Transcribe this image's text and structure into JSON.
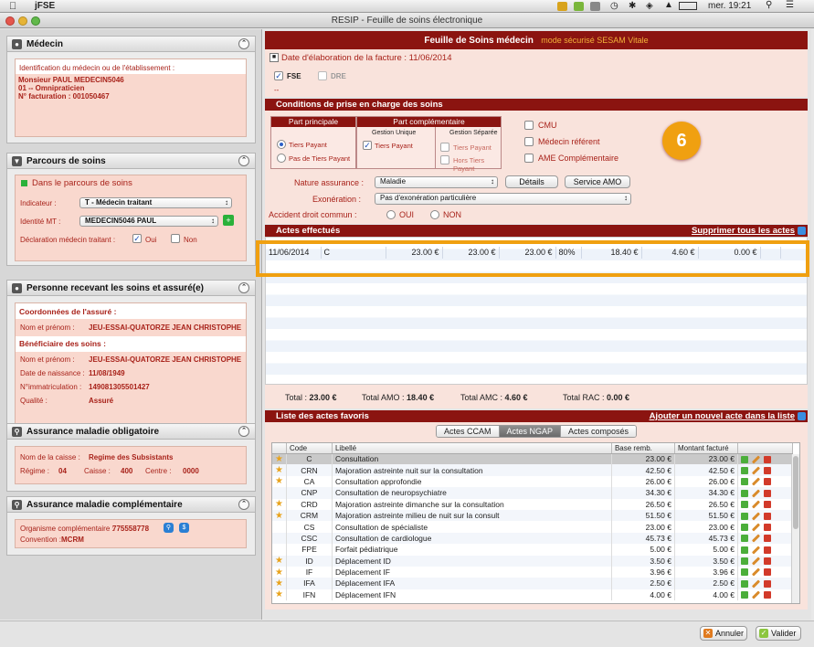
{
  "menubar": {
    "apple": "",
    "app": "jFSE",
    "clock": "mer. 19:21"
  },
  "window": {
    "title": "RESIP - Feuille de soins électronique"
  },
  "medecin": {
    "title": "Médecin",
    "ident_label": "Identification du médecin ou de l'établissement :",
    "line1": "Monsieur PAUL MEDECIN5046",
    "line2": "01 -- Omnipraticien",
    "line3": "N° facturation : 001050467"
  },
  "parcours": {
    "title": "Parcours de soins",
    "status": "Dans le parcours de soins",
    "indicateur_label": "Indicateur :",
    "indicateur_value": "T - Médecin traitant",
    "identite_label": "Identité MT :",
    "identite_value": "MEDECIN5046 PAUL",
    "declaration_label": "Déclaration médecin traitant :",
    "oui": "Oui",
    "non": "Non"
  },
  "personne": {
    "title": "Personne recevant les soins et assuré(e)",
    "coord_label": "Coordonnées de l'assuré :",
    "nom_label": "Nom et prénom :",
    "nom_value": "JEU-ESSAI-QUATORZE JEAN CHRISTOPHE",
    "benef_label": "Bénéficiaire des soins :",
    "nom2_label": "Nom et prénom :",
    "nom2_value": "JEU-ESSAI-QUATORZE JEAN CHRISTOPHE",
    "naissance_label": "Date de naissance :",
    "naissance_value": "11/08/1949",
    "immat_label": "N°immatriculation :",
    "immat_value": "149081305501427",
    "qualite_label": "Qualité :",
    "qualite_value": "Assuré"
  },
  "amo": {
    "title": "Assurance maladie obligatoire",
    "caisse_label": "Nom de la caisse :",
    "caisse_value": "Regime des Subsistants",
    "regime_label": "Régime :",
    "regime_value": "04",
    "caisse2_label": "Caisse :",
    "caisse2_value": "400",
    "centre_label": "Centre :",
    "centre_value": "0000"
  },
  "amc": {
    "title": "Assurance maladie complémentaire",
    "org_label": "Organisme complémentaire :",
    "org_value": "775558778",
    "conv_label": "Convention :",
    "conv_value": "MCRM"
  },
  "feuille": {
    "title": "Feuille de Soins médecin",
    "mode": "mode sécurisé SESAM Vitale",
    "date_label": "Date d'élaboration de la facture : 11/06/2014",
    "fse": "FSE",
    "dre": "DRE",
    "dashes": "--"
  },
  "conditions": {
    "title": "Conditions de prise en charge des soins",
    "part_principale": "Part principale",
    "part_comp": "Part complémentaire",
    "gestion_unique": "Gestion Unique",
    "gestion_separee": "Gestion Séparée",
    "tiers_payant": "Tiers Payant",
    "pas_tiers": "Pas de Tiers Payant",
    "tiers_payant2": "Tiers Payant",
    "tiers_payant3": "Tiers Payant",
    "hors_tiers": "Hors Tiers Payant",
    "cmu": "CMU",
    "medecin_refere": "Médecin référent",
    "ame": "AME Complémentaire",
    "nature_label": "Nature assurance :",
    "nature_value": "Maladie",
    "details": "Détails",
    "service_amo": "Service AMO",
    "exo_label": "Exonération :",
    "exo_value": "Pas d'exonération particulière",
    "accident_label": "Accident droit commun :",
    "oui": "OUI",
    "non": "NON",
    "badge": "6"
  },
  "actes": {
    "title": "Actes effectués",
    "delete_all": "Supprimer tous les actes",
    "row": [
      "11/06/2014",
      "C",
      "23.00 €",
      "23.00 €",
      "23.00 €",
      "80%",
      "18.40 €",
      "4.60 €",
      "0.00 €"
    ]
  },
  "totals": {
    "total_label": "Total :",
    "total": "23.00 €",
    "amo_label": "Total AMO :",
    "amo": "18.40 €",
    "amc_label": "Total AMC :",
    "amc": "4.60 €",
    "rac_label": "Total RAC :",
    "rac": "0.00 €"
  },
  "favoris": {
    "title": "Liste des actes favoris",
    "add": "Ajouter un nouvel acte dans la liste",
    "tabs": [
      "Actes CCAM",
      "Actes NGAP",
      "Actes composés"
    ],
    "headers": [
      "Code",
      "Libellé",
      "Base remb.",
      "Montant facturé"
    ],
    "rows": [
      {
        "star": true,
        "code": "C",
        "label": "Consultation",
        "base": "23.00 €",
        "montant": "23.00 €"
      },
      {
        "star": true,
        "code": "CRN",
        "label": "Majoration astreinte nuit sur la consultation",
        "base": "42.50 €",
        "montant": "42.50 €"
      },
      {
        "star": true,
        "code": "CA",
        "label": "Consultation approfondie",
        "base": "26.00 €",
        "montant": "26.00 €"
      },
      {
        "star": false,
        "code": "CNP",
        "label": "Consultation de neuropsychiatre",
        "base": "34.30 €",
        "montant": "34.30 €"
      },
      {
        "star": true,
        "code": "CRD",
        "label": "Majoration astreinte dimanche sur la consultation",
        "base": "26.50 €",
        "montant": "26.50 €"
      },
      {
        "star": true,
        "code": "CRM",
        "label": "Majoration astreinte milieu de nuit sur la consult",
        "base": "51.50 €",
        "montant": "51.50 €"
      },
      {
        "star": false,
        "code": "CS",
        "label": "Consultation de spécialiste",
        "base": "23.00 €",
        "montant": "23.00 €"
      },
      {
        "star": false,
        "code": "CSC",
        "label": "Consultation de cardiologue",
        "base": "45.73 €",
        "montant": "45.73 €"
      },
      {
        "star": false,
        "code": "FPE",
        "label": "Forfait pédiatrique",
        "base": "5.00 €",
        "montant": "5.00 €"
      },
      {
        "star": true,
        "code": "ID",
        "label": "Déplacement ID",
        "base": "3.50 €",
        "montant": "3.50 €"
      },
      {
        "star": true,
        "code": "IF",
        "label": "Déplacement IF",
        "base": "3.96 €",
        "montant": "3.96 €"
      },
      {
        "star": true,
        "code": "IFA",
        "label": "Déplacement IFA",
        "base": "2.50 €",
        "montant": "2.50 €"
      },
      {
        "star": true,
        "code": "IFN",
        "label": "Déplacement IFN",
        "base": "4.00 €",
        "montant": "4.00 €"
      }
    ]
  },
  "footer": {
    "annuler": "Annuler",
    "valider": "Valider"
  },
  "colors": {
    "accent": "#8b1410",
    "highlight": "#f0a010",
    "badge": "#f0a010"
  }
}
